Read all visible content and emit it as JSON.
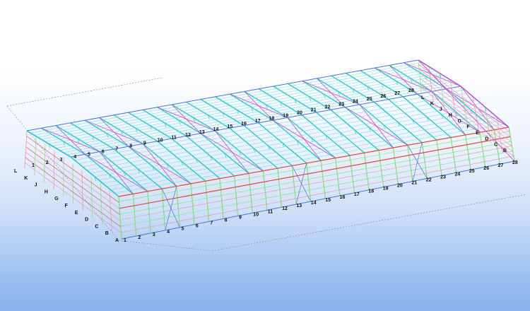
{
  "window": {
    "background_top": "#ffffff",
    "background_bottom": "#86b2ea"
  },
  "model": {
    "type": "3d-steel-frame-warehouse",
    "colors": {
      "rafter": "#22c8c8",
      "column": "#7ee07e",
      "purlin": "#6fd9d9",
      "brace": "#cc44cc",
      "girt_red": "#e0483c",
      "girt_pink": "#ef8ab0",
      "edge_blue": "#4a74d8",
      "ground_line": "#888888"
    },
    "grid_numbers_roof_back": [
      "1",
      "2",
      "3",
      "4",
      "5",
      "6",
      "7",
      "8",
      "9",
      "10",
      "11",
      "12",
      "13",
      "14",
      "15",
      "16",
      "17",
      "18",
      "19",
      "20",
      "21",
      "22",
      "23",
      "24",
      "25",
      "26",
      "27",
      "28"
    ],
    "grid_numbers_front": [
      "1",
      "2",
      "3",
      "4",
      "5",
      "6",
      "7",
      "8",
      "9",
      "10",
      "11",
      "12",
      "13",
      "14",
      "15",
      "16",
      "17",
      "18",
      "19",
      "20",
      "21",
      "22",
      "23",
      "24",
      "25",
      "26",
      "27",
      "28"
    ],
    "grid_letters_left": [
      "L",
      "K",
      "J",
      "H",
      "G",
      "F",
      "E",
      "D",
      "C",
      "B",
      "A"
    ],
    "grid_letters_right": [
      "L",
      "K",
      "J",
      "H",
      "G",
      "F",
      "E",
      "D",
      "C",
      "B"
    ]
  }
}
